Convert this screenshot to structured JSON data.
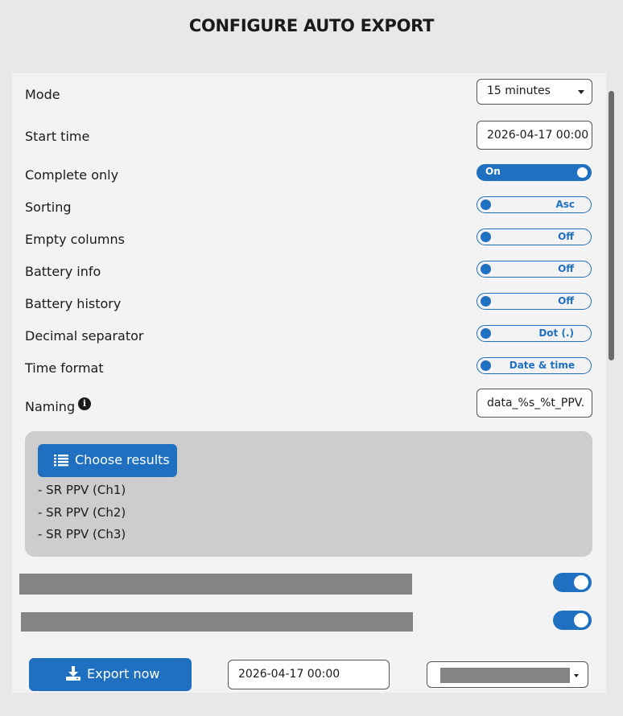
{
  "title": "CONFIGURE AUTO EXPORT",
  "settings": {
    "mode": {
      "label": "Mode",
      "value": "15 minutes"
    },
    "start_time": {
      "label": "Start time",
      "value": "2026-04-17 00:00"
    },
    "complete_only": {
      "label": "Complete only",
      "value": "On"
    },
    "sorting": {
      "label": "Sorting",
      "value": "Asc"
    },
    "empty_columns": {
      "label": "Empty columns",
      "value": "Off"
    },
    "battery_info": {
      "label": "Battery info",
      "value": "Off"
    },
    "battery_history": {
      "label": "Battery history",
      "value": "Off"
    },
    "decimal_separator": {
      "label": "Decimal separator",
      "value": "Dot (.)"
    },
    "time_format": {
      "label": "Time format",
      "value": "Date & time"
    },
    "naming": {
      "label": "Naming",
      "value": "data_%s_%t_PPV."
    }
  },
  "results": {
    "button_label": "Choose results",
    "items": [
      "- SR PPV (Ch1)",
      "- SR PPV (Ch2)",
      "- SR PPV (Ch3)"
    ]
  },
  "footer": {
    "export_label": "Export now",
    "date_value": "2026-04-17 00:00"
  },
  "colors": {
    "accent": "#1f70c1",
    "panel": "#f3f3f3",
    "results_bg": "#cdcdcd"
  }
}
